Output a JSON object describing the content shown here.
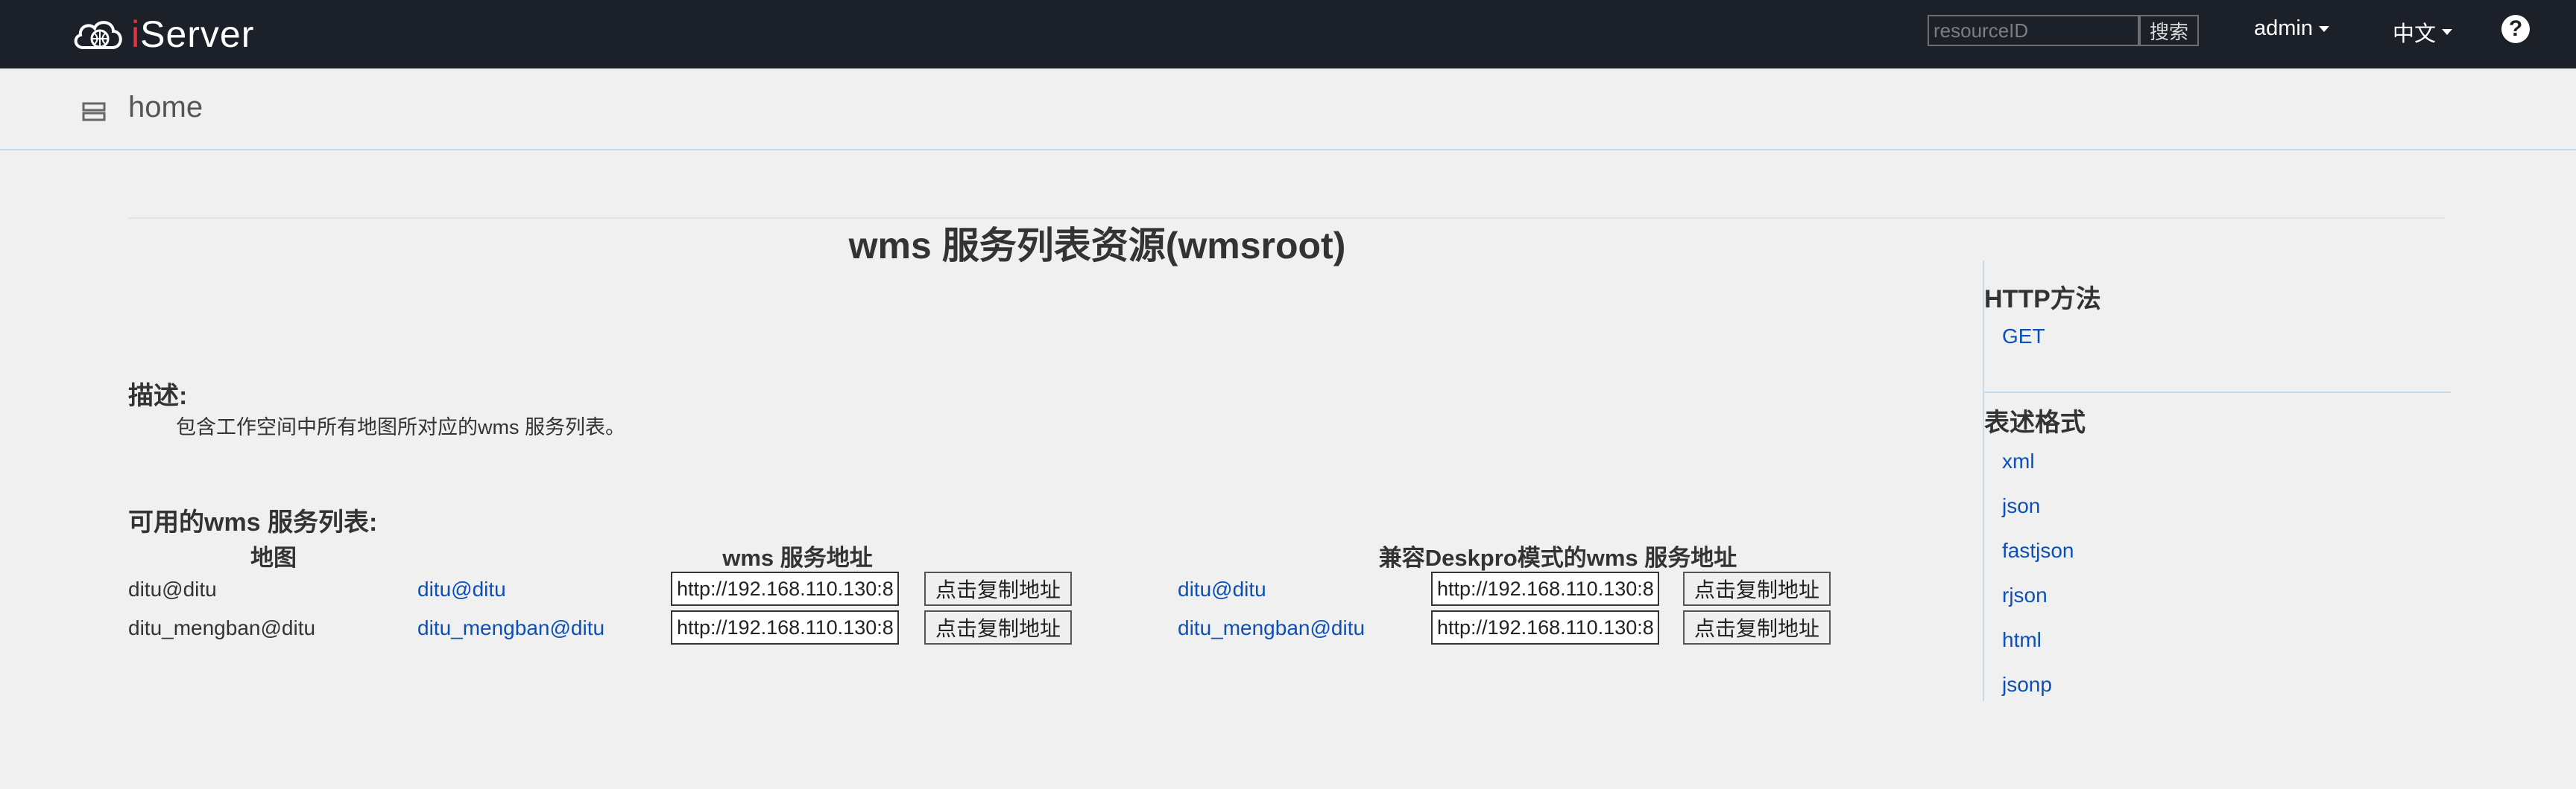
{
  "app": {
    "logo_text_prefix": "i",
    "logo_text_rest": "Server"
  },
  "header": {
    "search": {
      "placeholder": "resourceID",
      "button": "搜索"
    },
    "user_menu": "admin",
    "language_menu": "中文",
    "help": "?"
  },
  "breadcrumb": {
    "home": "home"
  },
  "page": {
    "title": "wms 服务列表资源(wmsroot)",
    "description_heading": "描述:",
    "description_text": "包含工作空间中所有地图所对应的wms 服务列表。",
    "list_heading": "可用的wms 服务列表:",
    "columns": [
      "地图",
      "wms 服务地址",
      "兼容Deskpro模式的wms 服务地址"
    ],
    "rows": [
      {
        "map": "ditu@ditu",
        "wms_link": "ditu@ditu",
        "wms_url": "http://192.168.110.130:8",
        "copy_label": "点击复制地址",
        "deskpro_link": "ditu@ditu",
        "deskpro_url": "http://192.168.110.130:8",
        "deskpro_copy_label": "点击复制地址"
      },
      {
        "map": "ditu_mengban@ditu",
        "wms_link": "ditu_mengban@ditu",
        "wms_url": "http://192.168.110.130:8",
        "copy_label": "点击复制地址",
        "deskpro_link": "ditu_mengban@ditu",
        "deskpro_url": "http://192.168.110.130:8",
        "deskpro_copy_label": "点击复制地址"
      }
    ]
  },
  "sidebar": {
    "http_heading": "HTTP方法",
    "http_methods": [
      "GET"
    ],
    "format_heading": "表述格式",
    "formats": [
      "xml",
      "json",
      "fastjson",
      "rjson",
      "html",
      "jsonp"
    ]
  },
  "colors": {
    "topbar": "#1b2029",
    "link": "#0b50b8",
    "logo_accent": "#e5323e",
    "background": "#f0f0f0"
  }
}
